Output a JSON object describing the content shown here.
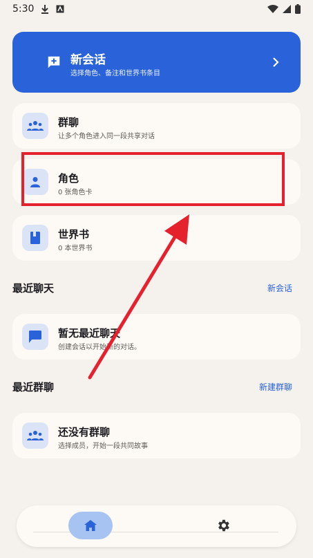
{
  "status_bar": {
    "time": "5:30"
  },
  "hero": {
    "title": "新会话",
    "subtitle": "选择角色、备注和世界书条目"
  },
  "cards": [
    {
      "title": "群聊",
      "subtitle": "让多个角色进入同一段共享对话"
    },
    {
      "title": "角色",
      "subtitle": "0 张角色卡"
    },
    {
      "title": "世界书",
      "subtitle": "0 本世界书"
    }
  ],
  "recent_chats": {
    "title": "最近聊天",
    "action": "新会话",
    "empty_title": "暂无最近聊天",
    "empty_subtitle": "创建会话以开始新的对话。"
  },
  "recent_groups": {
    "title": "最近群聊",
    "action": "新建群聊",
    "empty_title": "还没有群聊",
    "empty_subtitle": "选择成员，开始一段共同故事"
  },
  "colors": {
    "accent": "#2962d9",
    "annotation": "#e6212e",
    "background": "#f5f2ee"
  }
}
